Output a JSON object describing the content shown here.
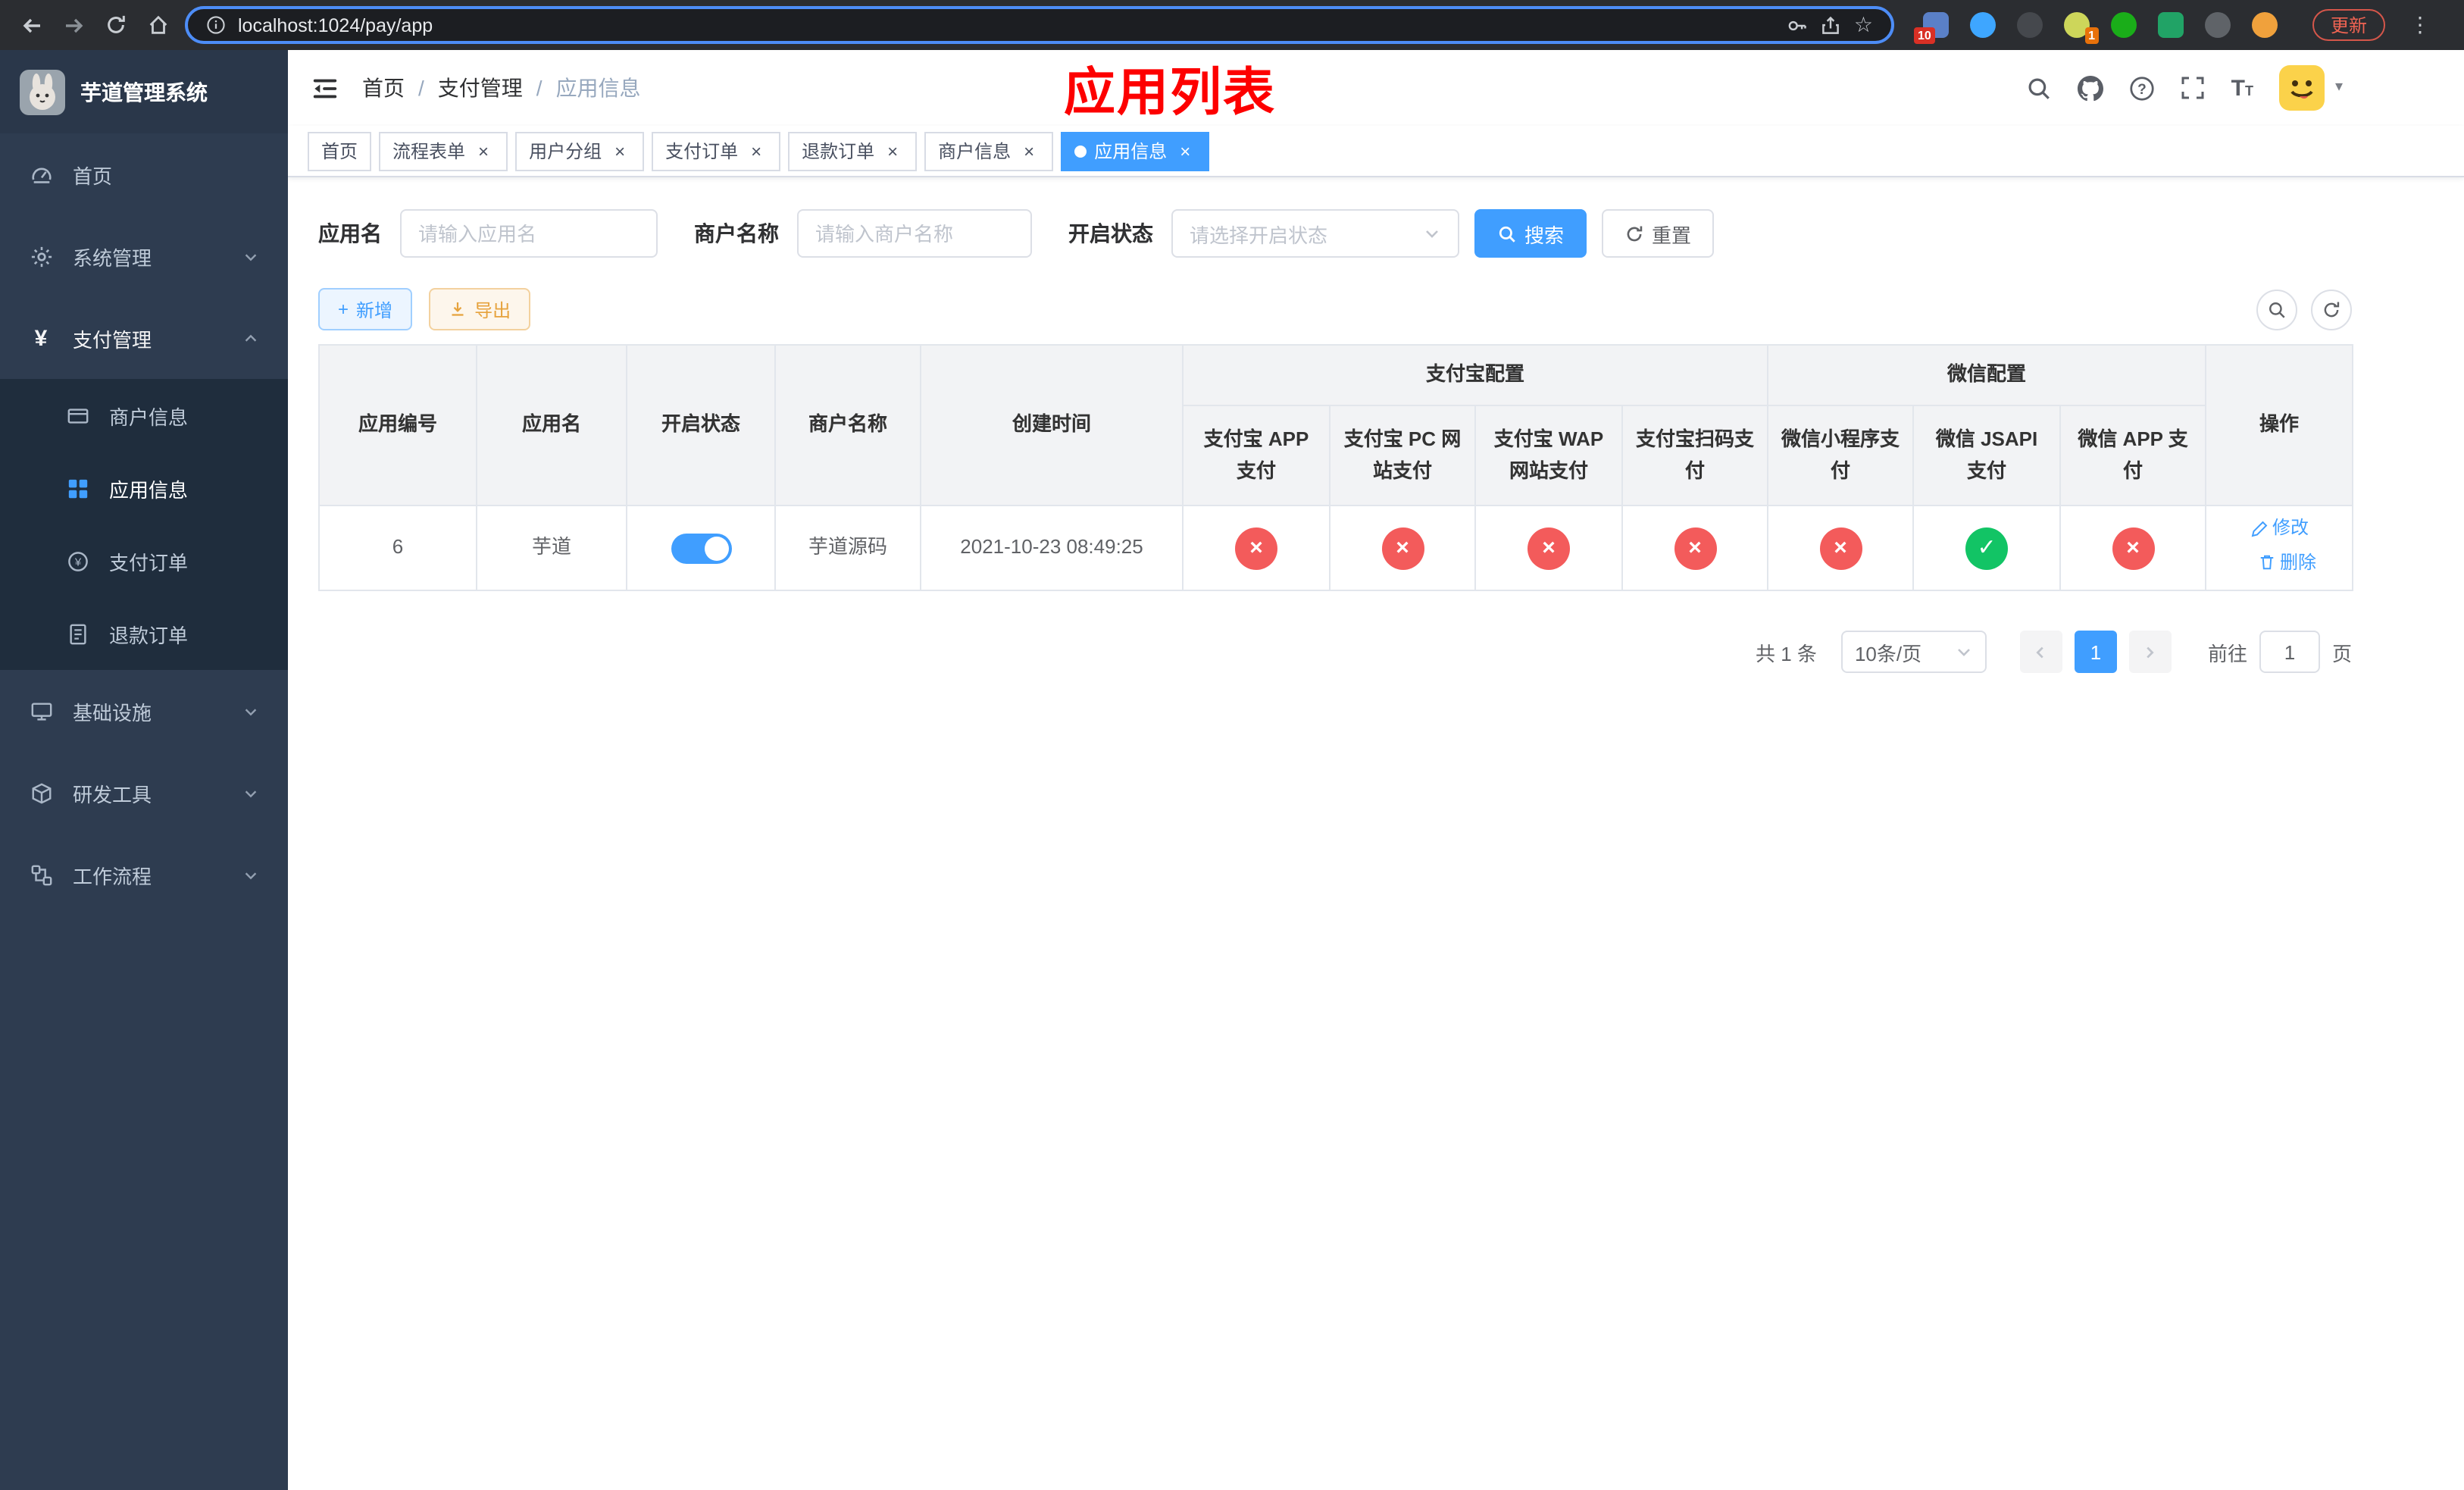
{
  "browser": {
    "url": "localhost:1024/pay/app",
    "update_label": "更新",
    "ext_badge_1": "10",
    "ext_badge_2": "1"
  },
  "icons": {
    "close": "×",
    "check": "✓",
    "cross": "×",
    "caret_down": "▾",
    "dots_vertical": "⋮",
    "plus": "+",
    "star": "☆",
    "yen": "¥"
  },
  "colors": {
    "primary": "#409eff",
    "danger": "#f35b5b",
    "success": "#12c465",
    "annotation": "#fd0000"
  },
  "sidebar": {
    "logo_title": "芋道管理系统",
    "items": [
      {
        "label": "首页"
      },
      {
        "label": "系统管理"
      },
      {
        "label": "支付管理"
      },
      {
        "label": "基础设施"
      },
      {
        "label": "研发工具"
      },
      {
        "label": "工作流程"
      }
    ],
    "payment_children": [
      {
        "label": "商户信息"
      },
      {
        "label": "应用信息"
      },
      {
        "label": "支付订单"
      },
      {
        "label": "退款订单"
      }
    ]
  },
  "header": {
    "breadcrumb": [
      "首页",
      "支付管理",
      "应用信息"
    ],
    "annotation_title": "应用列表"
  },
  "tabs": [
    {
      "label": "首页"
    },
    {
      "label": "流程表单"
    },
    {
      "label": "用户分组"
    },
    {
      "label": "支付订单"
    },
    {
      "label": "退款订单"
    },
    {
      "label": "商户信息"
    },
    {
      "label": "应用信息"
    }
  ],
  "filters": {
    "app_name_label": "应用名",
    "app_name_placeholder": "请输入应用名",
    "merchant_label": "商户名称",
    "merchant_placeholder": "请输入商户名称",
    "status_label": "开启状态",
    "status_placeholder": "请选择开启状态",
    "search_label": "搜索",
    "reset_label": "重置"
  },
  "toolbar": {
    "add_label": "新增",
    "export_label": "导出"
  },
  "table": {
    "headers": {
      "app_id": "应用编号",
      "app_name": "应用名",
      "status": "开启状态",
      "merchant": "商户名称",
      "created": "创建时间",
      "alipay_group": "支付宝配置",
      "wechat_group": "微信配置",
      "alipay_app": "支付宝 APP 支付",
      "alipay_pc": "支付宝 PC 网站支付",
      "alipay_wap": "支付宝 WAP 网站支付",
      "alipay_scan": "支付宝扫码支付",
      "wx_mini": "微信小程序支付",
      "wx_jsapi": "微信 JSAPI 支付",
      "wx_app": "微信 APP 支付",
      "actions": "操作"
    },
    "rows": [
      {
        "app_id": "6",
        "app_name": "芋道",
        "enabled": true,
        "merchant": "芋道源码",
        "created": "2021-10-23 08:49:25",
        "configs": [
          false,
          false,
          false,
          false,
          false,
          true,
          false
        ],
        "edit_label": "修改",
        "delete_label": "删除"
      }
    ]
  },
  "pagination": {
    "total": "共 1 条",
    "page_size": "10条/页",
    "page": "1",
    "goto_label": "前往",
    "goto_value": "1",
    "unit_label": "页"
  }
}
